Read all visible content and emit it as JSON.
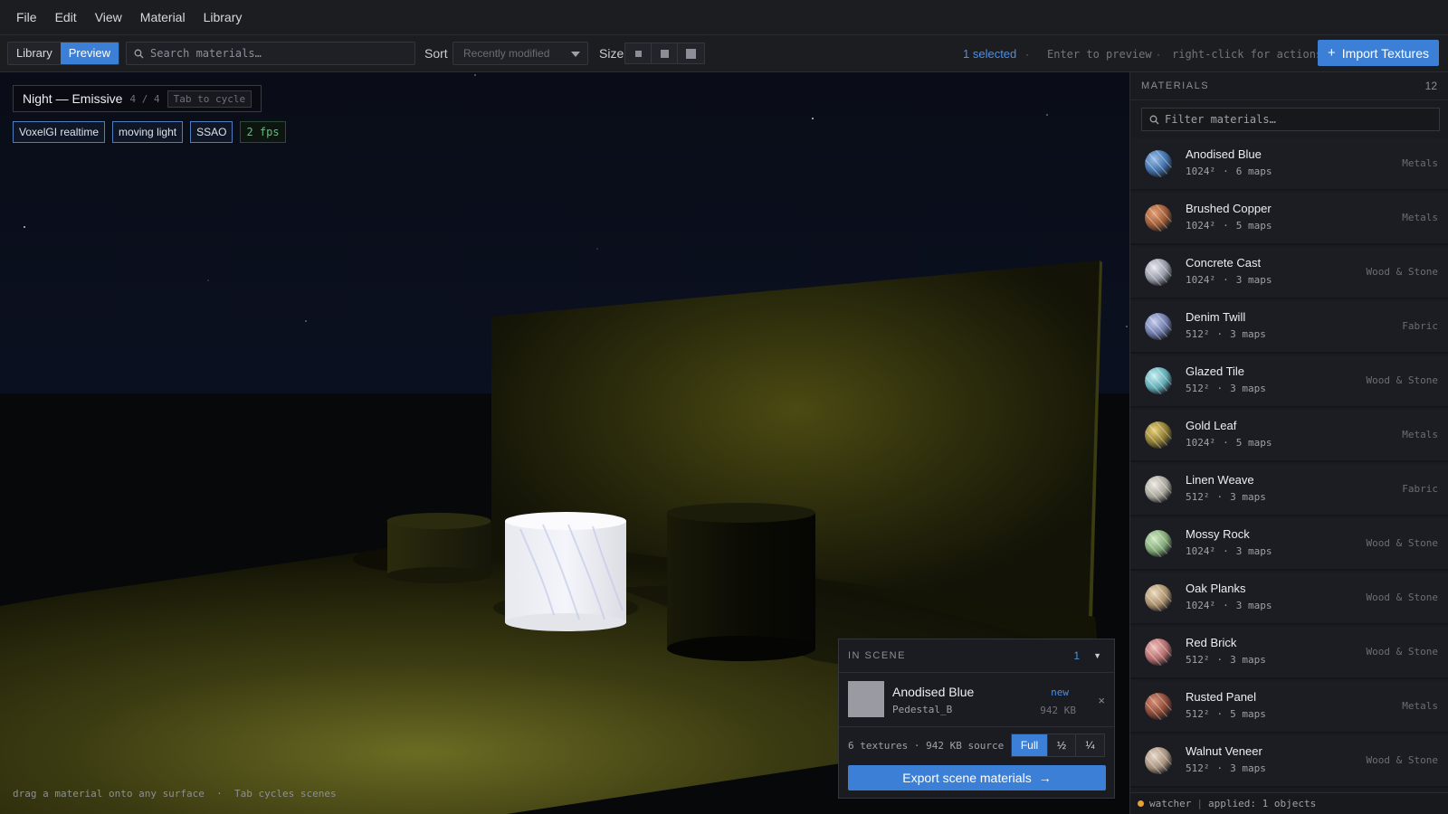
{
  "menu": [
    "File",
    "Edit",
    "View",
    "Material",
    "Library"
  ],
  "toolbar": {
    "mode_tabs": [
      {
        "label": "Library",
        "active": false
      },
      {
        "label": "Preview",
        "active": true
      }
    ],
    "search_placeholder": "Search materials…",
    "sort_label": "Sort",
    "sort_value": "Recently modified",
    "size_label": "Size",
    "selected_text": "1 selected",
    "hint_preview": "Enter to preview",
    "hint_actions": "right-click for actions",
    "hint_separator": "·",
    "import_label": "Import Textures",
    "import_icon": "plus-icon"
  },
  "viewport": {
    "scene_title": "Night — Emissive",
    "scene_counter": "4 / 4",
    "scene_hint": "Tab to cycle",
    "tags": [
      "VoxelGI realtime",
      "moving light",
      "SSAO"
    ],
    "fps": "2 fps",
    "bottom_hint": "drag a material onto any surface  ·  Tab cycles scenes"
  },
  "in_scene": {
    "title": "IN SCENE",
    "count": "1",
    "chevron_icon": "chevron-down-icon",
    "item": {
      "name": "Anodised Blue",
      "object": "Pedestal_B",
      "badge": "new",
      "size": "942 KB",
      "swatch_color": "#9a9aa2"
    },
    "source_summary": "6 textures · 942 KB source",
    "resolutions": [
      "Full",
      "½",
      "¼"
    ],
    "selected_resolution": "Full",
    "export_label": "Export scene materials",
    "export_icon": "arrow-right-icon"
  },
  "sidebar": {
    "title": "MATERIALS",
    "count": "12",
    "filter_placeholder": "Filter materials…",
    "materials": [
      {
        "name": "Anodised Blue",
        "size": "1024²",
        "maps": "6 maps",
        "category": "Metals",
        "color": "#3f6fa8",
        "hi": "#9cc0ea"
      },
      {
        "name": "Brushed Copper",
        "size": "1024²",
        "maps": "5 maps",
        "category": "Metals",
        "color": "#9a5a35",
        "hi": "#e9a27a"
      },
      {
        "name": "Concrete Cast",
        "size": "1024²",
        "maps": "3 maps",
        "category": "Wood & Stone",
        "color": "#9498a4",
        "hi": "#e9ebf1"
      },
      {
        "name": "Denim Twill",
        "size": "512²",
        "maps": "3 maps",
        "category": "Fabric",
        "color": "#6c78a8",
        "hi": "#c8cff0"
      },
      {
        "name": "Glazed Tile",
        "size": "512²",
        "maps": "3 maps",
        "category": "Wood & Stone",
        "color": "#5eaab3",
        "hi": "#c9f0f2"
      },
      {
        "name": "Gold Leaf",
        "size": "1024²",
        "maps": "5 maps",
        "category": "Metals",
        "color": "#8c7a32",
        "hi": "#e8d27a"
      },
      {
        "name": "Linen Weave",
        "size": "512²",
        "maps": "3 maps",
        "category": "Fabric",
        "color": "#a7a49a",
        "hi": "#efece4"
      },
      {
        "name": "Mossy Rock",
        "size": "1024²",
        "maps": "3 maps",
        "category": "Wood & Stone",
        "color": "#7fa573",
        "hi": "#d2ecc6"
      },
      {
        "name": "Oak Planks",
        "size": "1024²",
        "maps": "3 maps",
        "category": "Wood & Stone",
        "color": "#a88e6a",
        "hi": "#eedcc0"
      },
      {
        "name": "Red Brick",
        "size": "512²",
        "maps": "3 maps",
        "category": "Wood & Stone",
        "color": "#b16b6b",
        "hi": "#f2c1bd"
      },
      {
        "name": "Rusted Panel",
        "size": "512²",
        "maps": "5 maps",
        "category": "Metals",
        "color": "#8a4836",
        "hi": "#d99378"
      },
      {
        "name": "Walnut Veneer",
        "size": "512²",
        "maps": "3 maps",
        "category": "Wood & Stone",
        "color": "#a5907c",
        "hi": "#eadbcb"
      }
    ],
    "status_label": "watcher",
    "status_sep": "|",
    "status_text": "applied: 1 objects",
    "status_color": "#e3a33a"
  },
  "colors": {
    "accent": "#3c7fd6",
    "accent_text": "#4b90e6"
  }
}
